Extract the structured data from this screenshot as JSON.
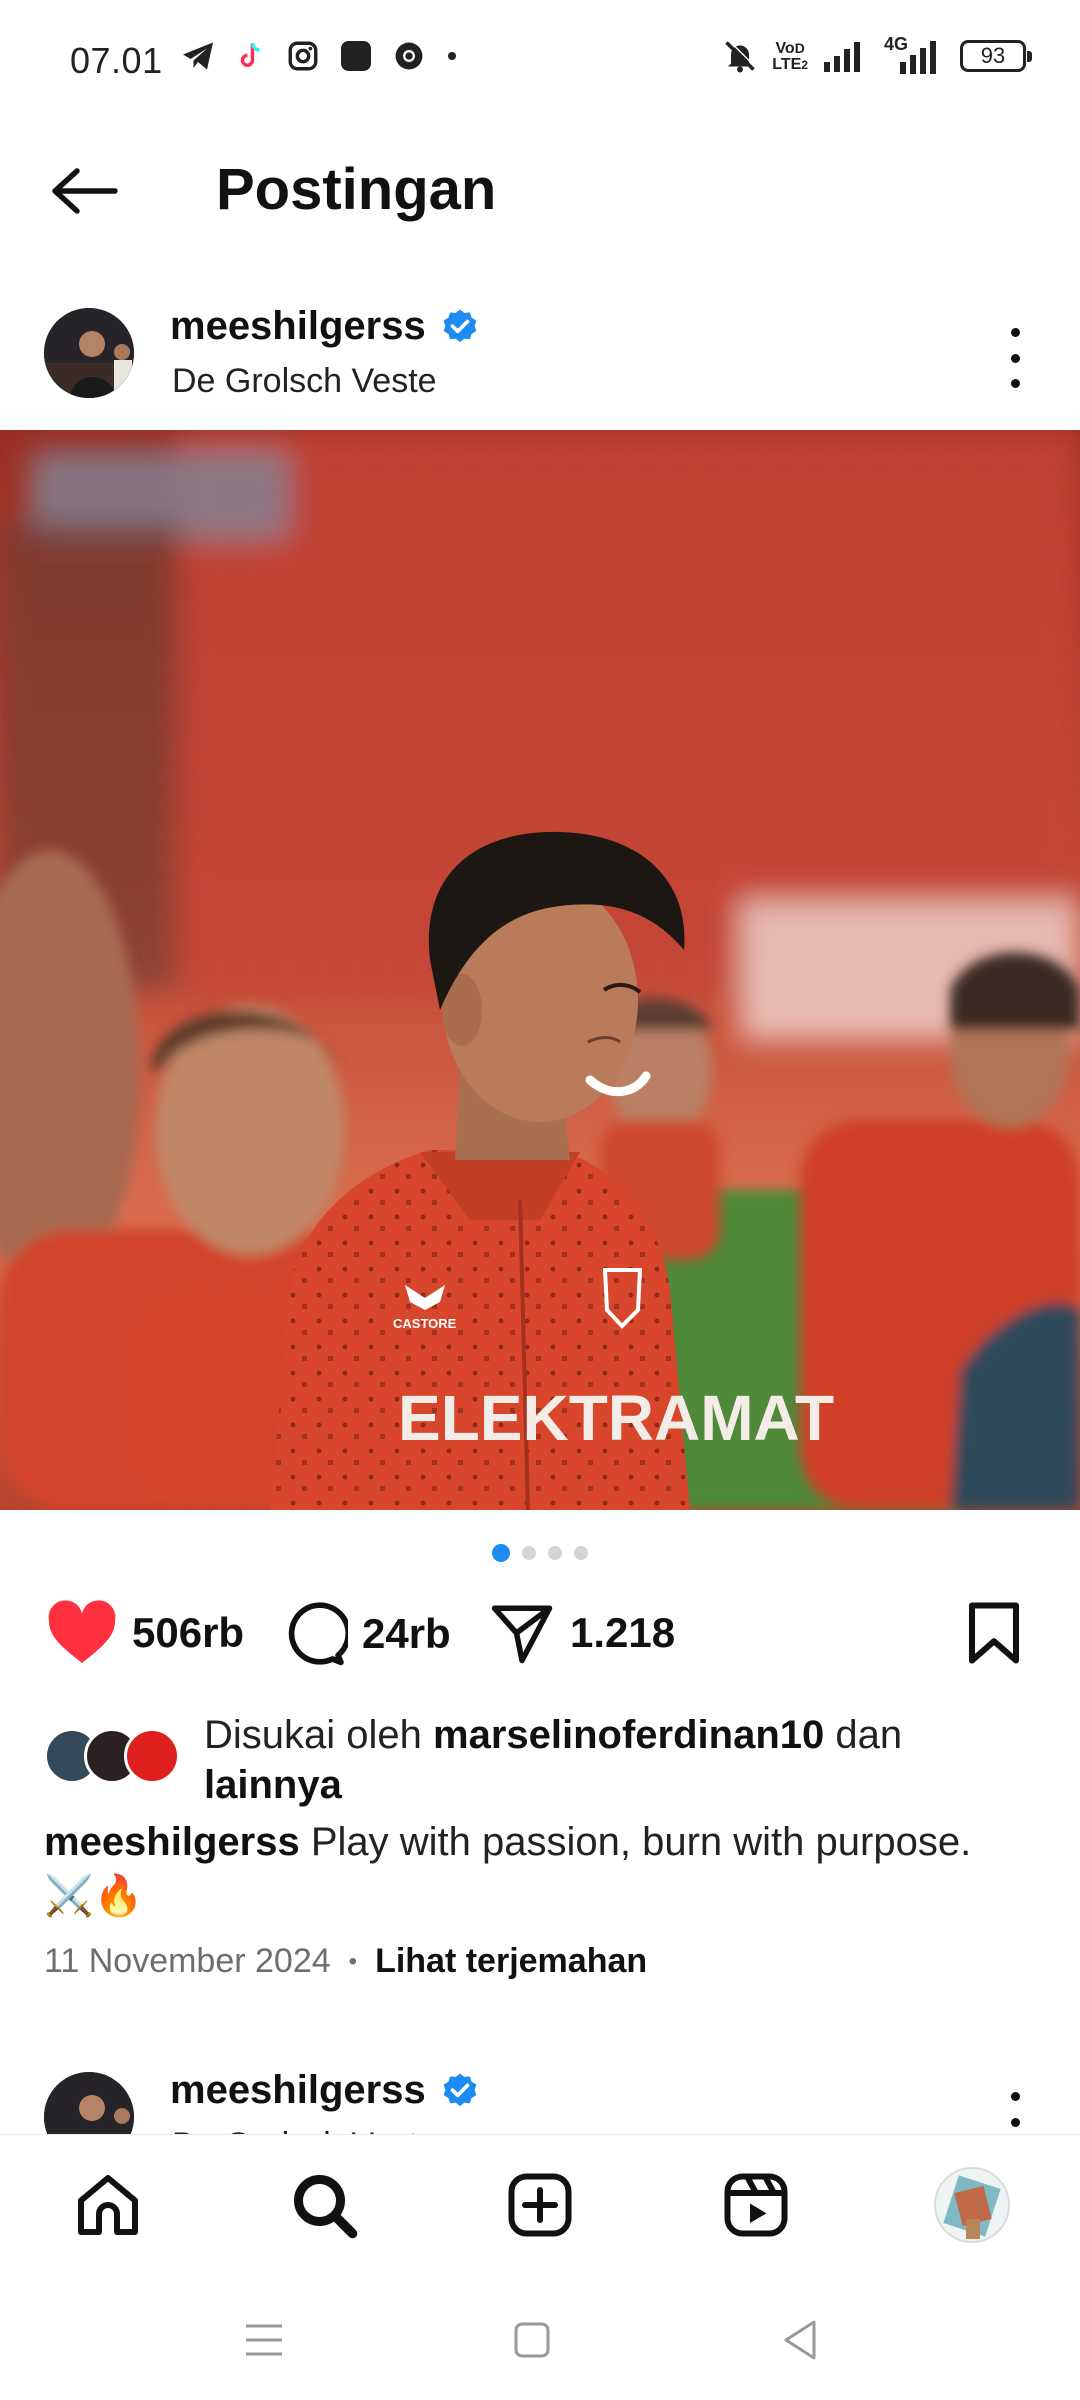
{
  "status_bar": {
    "time": "07.01",
    "battery": "93",
    "network_label": "4G",
    "volte_label": "VoLTE2",
    "left_icons": [
      "telegram-icon",
      "tiktok-icon",
      "instagram-icon",
      "app-square-icon",
      "chrome-icon",
      "dot-icon"
    ],
    "right_icons": [
      "mute-bell-icon",
      "volte-icon",
      "signal-icon",
      "signal-4g-icon",
      "battery-icon"
    ]
  },
  "header": {
    "title": "Postingan",
    "back_icon": "arrow-left-icon"
  },
  "post": {
    "username": "meeshilgerss",
    "verified": true,
    "location": "De Grolsch Veste",
    "photo_text": {
      "sponsor": "ELEKTRAMAT",
      "brand": "CASTORE"
    },
    "carousel": {
      "count": 4,
      "active": 0
    },
    "likes": "506rb",
    "comments": "24rb",
    "shares": "1.218",
    "liked_by": {
      "prefix": "Disukai oleh",
      "user": "marselinoferdinan10",
      "connector": "dan",
      "suffix": "lainnya"
    },
    "caption": {
      "username": "meeshilgerss",
      "text": "Play with passion, burn with purpose.",
      "emoji": "⚔️🔥"
    },
    "date": "11 November 2024",
    "separator": "•",
    "translate": "Lihat terjemahan"
  },
  "next_post": {
    "username": "meeshilgerss",
    "location": "De Grolsch Veste"
  },
  "bottom_nav": {
    "items": [
      "home-icon",
      "search-icon",
      "create-icon",
      "reels-icon",
      "profile-avatar"
    ]
  },
  "colors": {
    "accent_blue": "#1d8cf0",
    "like_red": "#ff3040",
    "kit_orange": "#d8462b"
  }
}
